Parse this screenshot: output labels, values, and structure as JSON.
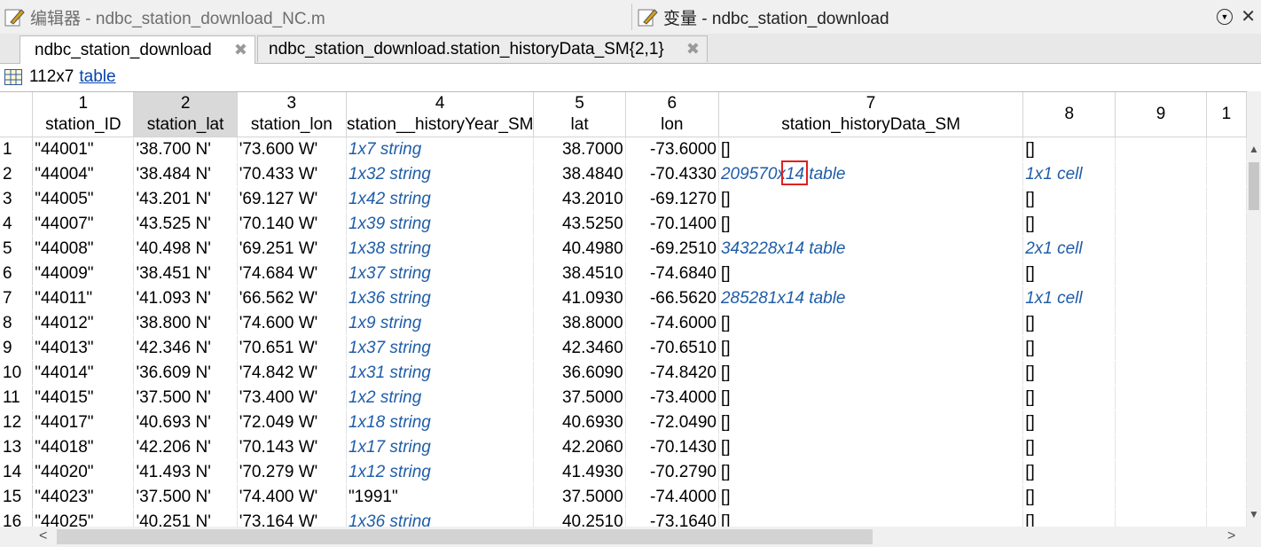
{
  "window": {
    "left_title": "编辑器 - ndbc_station_download_NC.m",
    "right_title": "变量 - ndbc_station_download"
  },
  "tabs": [
    {
      "label": "ndbc_station_download",
      "close": "✖"
    },
    {
      "label": "ndbc_station_download.station_historyData_SM{2,1}",
      "close": "✖"
    }
  ],
  "info": {
    "dims": "112x7",
    "type_link": "table"
  },
  "columns": [
    {
      "num": "1",
      "name": "station_ID"
    },
    {
      "num": "2",
      "name": "station_lat"
    },
    {
      "num": "3",
      "name": "station_lon"
    },
    {
      "num": "4",
      "name": "station__historyYear_SM"
    },
    {
      "num": "5",
      "name": "lat"
    },
    {
      "num": "6",
      "name": "lon"
    },
    {
      "num": "7",
      "name": "station_historyData_SM"
    },
    {
      "num": "8",
      "name": ""
    },
    {
      "num": "9",
      "name": ""
    },
    {
      "num": "1",
      "name": ""
    }
  ],
  "rows": [
    {
      "n": "1",
      "id": "\"44001\"",
      "slat": "'38.700 N'",
      "slon": "'73.600 W'",
      "hy": "1x7 string",
      "lat": "38.7000",
      "lon": "-73.6000",
      "hd": "[]",
      "hd2": "[]"
    },
    {
      "n": "2",
      "id": "\"44004\"",
      "slat": "'38.484 N'",
      "slon": "'70.433 W'",
      "hy": "1x32 string",
      "lat": "38.4840",
      "lon": "-70.4330",
      "hd": "209570x14 table",
      "hd2": "1x1 cell"
    },
    {
      "n": "3",
      "id": "\"44005\"",
      "slat": "'43.201 N'",
      "slon": "'69.127 W'",
      "hy": "1x42 string",
      "lat": "43.2010",
      "lon": "-69.1270",
      "hd": "[]",
      "hd2": "[]"
    },
    {
      "n": "4",
      "id": "\"44007\"",
      "slat": "'43.525 N'",
      "slon": "'70.140 W'",
      "hy": "1x39 string",
      "lat": "43.5250",
      "lon": "-70.1400",
      "hd": "[]",
      "hd2": "[]"
    },
    {
      "n": "5",
      "id": "\"44008\"",
      "slat": "'40.498 N'",
      "slon": "'69.251 W'",
      "hy": "1x38 string",
      "lat": "40.4980",
      "lon": "-69.2510",
      "hd": "343228x14 table",
      "hd2": "2x1 cell"
    },
    {
      "n": "6",
      "id": "\"44009\"",
      "slat": "'38.451 N'",
      "slon": "'74.684 W'",
      "hy": "1x37 string",
      "lat": "38.4510",
      "lon": "-74.6840",
      "hd": "[]",
      "hd2": "[]"
    },
    {
      "n": "7",
      "id": "\"44011\"",
      "slat": "'41.093 N'",
      "slon": "'66.562 W'",
      "hy": "1x36 string",
      "lat": "41.0930",
      "lon": "-66.5620",
      "hd": "285281x14 table",
      "hd2": "1x1 cell"
    },
    {
      "n": "8",
      "id": "\"44012\"",
      "slat": "'38.800 N'",
      "slon": "'74.600 W'",
      "hy": "1x9 string",
      "lat": "38.8000",
      "lon": "-74.6000",
      "hd": "[]",
      "hd2": "[]"
    },
    {
      "n": "9",
      "id": "\"44013\"",
      "slat": "'42.346 N'",
      "slon": "'70.651 W'",
      "hy": "1x37 string",
      "lat": "42.3460",
      "lon": "-70.6510",
      "hd": "[]",
      "hd2": "[]"
    },
    {
      "n": "10",
      "id": "\"44014\"",
      "slat": "'36.609 N'",
      "slon": "'74.842 W'",
      "hy": "1x31 string",
      "lat": "36.6090",
      "lon": "-74.8420",
      "hd": "[]",
      "hd2": "[]"
    },
    {
      "n": "11",
      "id": "\"44015\"",
      "slat": "'37.500 N'",
      "slon": "'73.400 W'",
      "hy": "1x2 string",
      "lat": "37.5000",
      "lon": "-73.4000",
      "hd": "[]",
      "hd2": "[]"
    },
    {
      "n": "12",
      "id": "\"44017\"",
      "slat": "'40.693 N'",
      "slon": "'72.049 W'",
      "hy": "1x18 string",
      "lat": "40.6930",
      "lon": "-72.0490",
      "hd": "[]",
      "hd2": "[]"
    },
    {
      "n": "13",
      "id": "\"44018\"",
      "slat": "'42.206 N'",
      "slon": "'70.143 W'",
      "hy": "1x17 string",
      "lat": "42.2060",
      "lon": "-70.1430",
      "hd": "[]",
      "hd2": "[]"
    },
    {
      "n": "14",
      "id": "\"44020\"",
      "slat": "'41.493 N'",
      "slon": "'70.279 W'",
      "hy": "1x12 string",
      "lat": "41.4930",
      "lon": "-70.2790",
      "hd": "[]",
      "hd2": "[]"
    },
    {
      "n": "15",
      "id": "\"44023\"",
      "slat": "'37.500 N'",
      "slon": "'74.400 W'",
      "hy": "\"1991\"",
      "lat": "37.5000",
      "lon": "-74.4000",
      "hd": "[]",
      "hd2": "[]"
    },
    {
      "n": "16",
      "id": "\"44025\"",
      "slat": "'40.251 N'",
      "slon": "'73.164 W'",
      "hy": "1x36 string",
      "lat": "40.2510",
      "lon": "-73.1640",
      "hd": "[]",
      "hd2": "[]"
    }
  ],
  "colors": {
    "link_blue": "#1f5da8",
    "selected_header": "#d9d9d9",
    "highlight_box": "#e02020"
  }
}
